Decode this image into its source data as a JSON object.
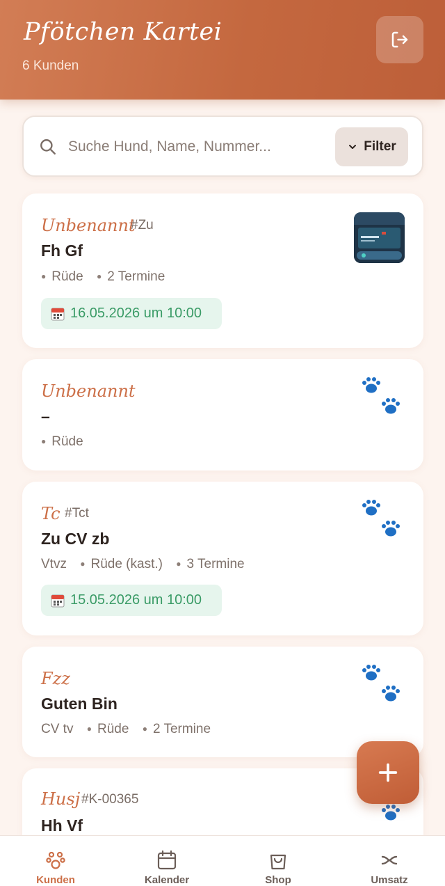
{
  "header": {
    "title": "Pfötchen Kartei",
    "subtitle": "6 Kunden"
  },
  "search": {
    "placeholder": "Suche Hund, Name, Nummer...",
    "value": "",
    "filter_label": "Filter"
  },
  "cards": [
    {
      "dog_name": "Unbenannt",
      "id": "#Zu",
      "owner": "Fh Gf",
      "meta": [
        "Rüde",
        "2 Termine"
      ],
      "appointment": "16.05.2026 um 10:00",
      "avatar": "photo"
    },
    {
      "dog_name": "Unbenannt",
      "owner": "–",
      "meta": [
        "Rüde"
      ],
      "avatar": "paw-icon"
    },
    {
      "dog_name": "Tc",
      "id": "#Tct",
      "owner": "Zu CV zb",
      "breed": "Vtvz",
      "meta": [
        "Rüde (kast.)",
        "3 Termine"
      ],
      "appointment": "15.05.2026 um 10:00",
      "avatar": "paw-icon"
    },
    {
      "dog_name": "Fzz",
      "owner": "Guten Bin",
      "breed": "CV tv",
      "meta": [
        "Rüde",
        "2 Termine"
      ],
      "avatar": "paw-icon"
    },
    {
      "dog_name": "Husj",
      "id": "#K-00365",
      "owner": "Hh Vf",
      "avatar": "paw-icon"
    }
  ],
  "nav": [
    {
      "label": "Kunden",
      "icon": "paw-outline-icon",
      "active": true
    },
    {
      "label": "Kalender",
      "icon": "calendar-icon",
      "active": false
    },
    {
      "label": "Shop",
      "icon": "shopping-bag-icon",
      "active": false
    },
    {
      "label": "Umsatz",
      "icon": "revenue-icon",
      "active": false
    }
  ],
  "colors": {
    "brand": "#c4683f",
    "accent_text": "#cc6f47",
    "appointment_bg": "#e6f5ed",
    "appointment_text": "#3a9b66",
    "paw_blue": "#1f6fc4"
  }
}
